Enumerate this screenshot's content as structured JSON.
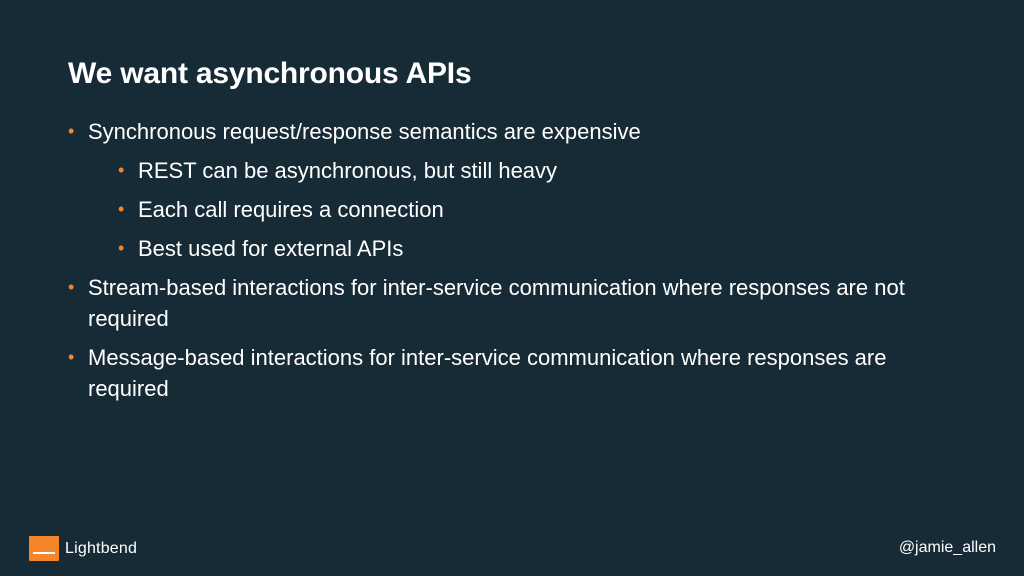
{
  "slide": {
    "title": "We want asynchronous APIs",
    "bullets": [
      {
        "level": 1,
        "text": "Synchronous request/response semantics are expensive"
      },
      {
        "level": 2,
        "text": "REST can be asynchronous, but still heavy"
      },
      {
        "level": 2,
        "text": "Each call requires a connection"
      },
      {
        "level": 2,
        "text": "Best used for external APIs"
      },
      {
        "level": 1,
        "text": "Stream-based interactions for inter-service communication where responses are not required"
      },
      {
        "level": 1,
        "text": "Message-based interactions for inter-service communication where responses are required"
      }
    ],
    "bullet_symbol": "•"
  },
  "footer": {
    "logo_text": "Lightbend",
    "logo_icon": "lightbend-logo-icon",
    "handle": "@jamie_allen"
  },
  "colors": {
    "background": "#172b36",
    "accent": "#f6852a",
    "text": "#ffffff"
  }
}
